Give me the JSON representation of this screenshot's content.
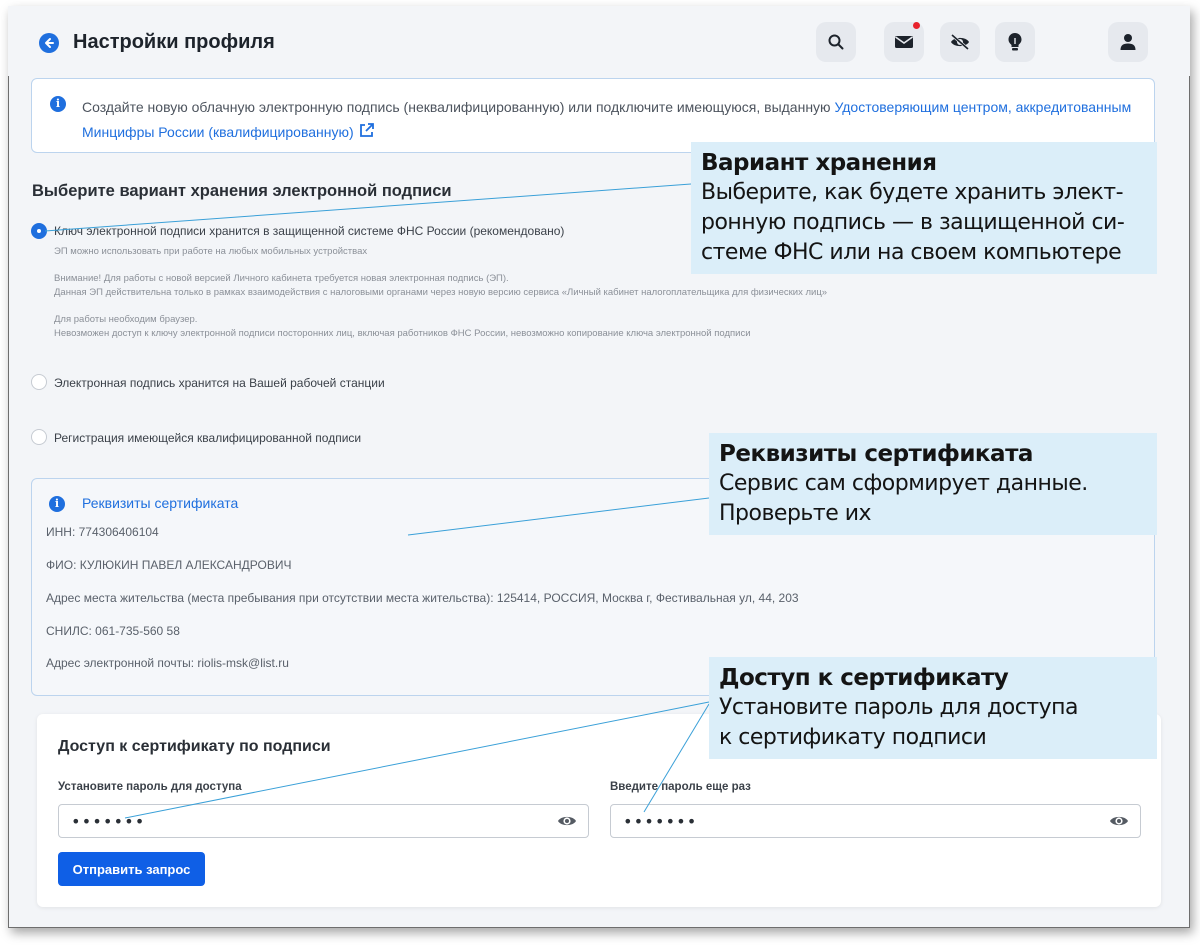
{
  "header": {
    "title": "Настройки профиля"
  },
  "info_banner": {
    "text": "Создайте новую облачную электронную подпись (неквалифицированную) или подключите имеющуюся, выданную ",
    "link": "Удостоверяющим центром, аккредитованным Минцифры России (квалифицированную)"
  },
  "storage": {
    "title": "Выберите вариант хранения электронной подписи",
    "options": [
      {
        "label": "Ключ электронной подписи хранится в защищенной системе ФНС России (рекомендовано)",
        "checked": true,
        "desc": [
          "ЭП можно использовать при работе на любых мобильных устройствах",
          "Внимание! Для работы с новой версией Личного кабинета требуется новая электронная подпись (ЭП).",
          "Данная ЭП действительна только в рамках взаимодействия с налоговыми органами через новую версию сервиса «Личный кабинет налогоплательщика для физических лиц»",
          "Для работы необходим браузер.",
          "Невозможен доступ к ключу электронной подписи посторонних лиц, включая работников ФНС России, невозможно копирование ключа электронной подписи"
        ]
      },
      {
        "label": "Электронная подпись хранится на Вашей рабочей станции",
        "checked": false
      },
      {
        "label": "Регистрация имеющейся квалифицированной подписи",
        "checked": false
      }
    ]
  },
  "certificate": {
    "title": "Реквизиты сертификата",
    "inn": "ИНН: 774306406104",
    "fio": "ФИО: КУЛЮКИН ПАВЕЛ АЛЕКСАНДРОВИЧ",
    "address": "Адрес места жительства (места пребывания при отсутствии места жительства): 125414, РОССИЯ, Москва г, Фестивальная ул, 44, 203",
    "snils": "СНИЛС: 061-735-560 58",
    "email": "Адрес электронной почты: riolis-msk@list.ru"
  },
  "access": {
    "title": "Доступ к сертификату по подписи",
    "password_label": "Установите пароль для доступа",
    "password_value": "•••••••",
    "repeat_label": "Введите пароль еще раз",
    "repeat_value": "•••••••",
    "submit_label": "Отправить запрос"
  },
  "callouts": {
    "storage": {
      "title": "Вариант хранения",
      "lines": [
        "Выберите, как будете хранить элект-",
        "ронную подпись — в защищенной си-",
        "стеме ФНС или на своем компьютере"
      ]
    },
    "certificate": {
      "title": "Реквизиты сертификата",
      "lines": [
        "Сервис сам сформирует данные.",
        "Проверьте их"
      ]
    },
    "access": {
      "title": "Доступ к сертификату",
      "lines": [
        "Установите пароль для доступа",
        "к сертификату подписи"
      ]
    }
  },
  "icons": {
    "back": "back-arrow-icon",
    "search": "search-icon",
    "mail": "mail-icon",
    "accessibility": "eye-off-icon",
    "hint": "lightbulb-icon",
    "profile": "user-icon",
    "info": "info-icon",
    "external": "external-link-icon",
    "show_password": "eye-icon"
  },
  "colors": {
    "accent": "#1f6fde",
    "button": "#0f5fe6",
    "notification": "#e8222c",
    "callout_bg": "#dbeef9"
  }
}
